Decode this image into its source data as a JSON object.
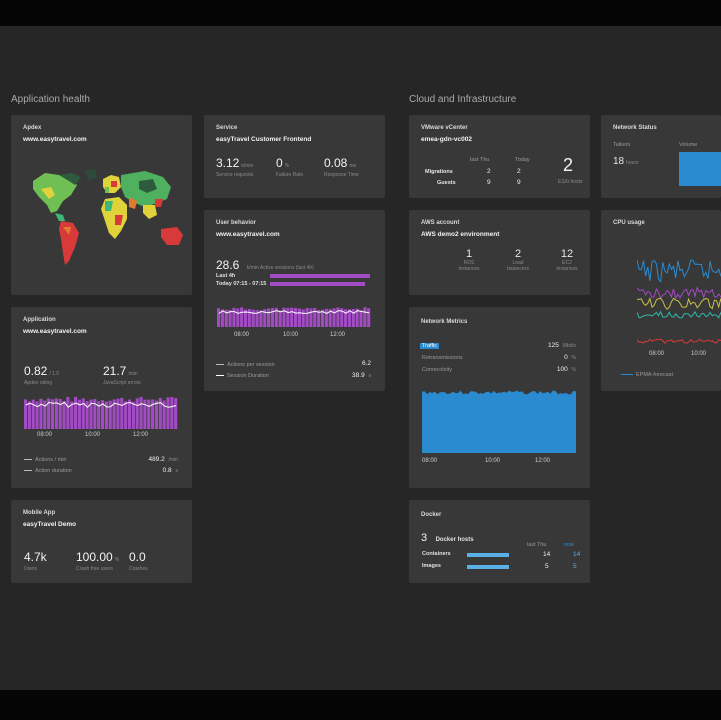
{
  "sections": {
    "app_health": "Application health",
    "cloud": "Cloud and Infrastructure"
  },
  "apdex": {
    "title": "Apdex",
    "subtitle": "www.easytravel.com"
  },
  "service": {
    "title": "Service",
    "subtitle": "easyTravel Customer Frontend",
    "metrics": [
      {
        "value": "3.12",
        "unit": "k/min",
        "label": "Service requests"
      },
      {
        "value": "0",
        "unit": "%",
        "label": "Failure Rate"
      },
      {
        "value": "0.08",
        "unit": "ms",
        "label": "Response Time"
      }
    ]
  },
  "user_behavior": {
    "title": "User behavior",
    "subtitle": "www.easytravel.com",
    "big": "28.6",
    "big_text": "k/min Active sessions (last 4h)",
    "rows": [
      {
        "label": "Last 4h",
        "fill": 1.0
      },
      {
        "label": "Today  07:15 - 07:15",
        "fill": 0.95
      }
    ],
    "x_ticks": [
      "08:00",
      "10:00",
      "12:00"
    ],
    "stats": [
      {
        "label": "Actions per session",
        "value": "6.2"
      },
      {
        "label": "Session Duration",
        "value": "38.9",
        "unit": "s"
      }
    ]
  },
  "application": {
    "title": "Application",
    "subtitle": "www.easytravel.com",
    "metrics": [
      {
        "value": "0.82",
        "unit": "/ 1.0",
        "label": "Apdex rating"
      },
      {
        "value": "21.7",
        "unit": "/min",
        "label": "JavaScript errors"
      }
    ],
    "x_ticks": [
      "08:00",
      "10:00",
      "12:00"
    ],
    "stats": [
      {
        "label": "Actions / min",
        "value": "489.2",
        "unit": "/min"
      },
      {
        "label": "Action duration",
        "value": "0.8",
        "unit": "s"
      }
    ]
  },
  "mobile": {
    "title": "Mobile App",
    "subtitle": "easyTravel Demo",
    "metrics": [
      {
        "value": "4.7k",
        "unit": "",
        "label": "Users"
      },
      {
        "value": "100.00",
        "unit": "%",
        "label": "Crash free users"
      },
      {
        "value": "0.0",
        "unit": "",
        "label": "Crashes"
      }
    ]
  },
  "vmware": {
    "title": "VMware vCenter",
    "subtitle": "emea-gdn-vc002",
    "col_headers": [
      "last Thu",
      "Today"
    ],
    "rows": [
      {
        "label": "Migrations",
        "a": "2",
        "b": "2"
      },
      {
        "label": "Guests",
        "a": "9",
        "b": "9"
      }
    ],
    "big": "2",
    "big_label": "ESXi hosts"
  },
  "aws": {
    "title": "AWS account",
    "subtitle": "AWS demo2 environment",
    "metrics": [
      {
        "value": "1",
        "label": "RDS instances"
      },
      {
        "value": "2",
        "label": "Load balancers"
      },
      {
        "value": "12",
        "label": "EC2 instances"
      }
    ]
  },
  "network_metrics": {
    "title": "Network Metrics",
    "rows": [
      {
        "label": "Traffic",
        "value": "125",
        "unit": "Mbit/s"
      },
      {
        "label": "Retransmissions",
        "value": "0",
        "unit": "%"
      },
      {
        "label": "Connectivity",
        "value": "100",
        "unit": "%"
      }
    ],
    "x_ticks": [
      "08:00",
      "10:00",
      "12:00"
    ]
  },
  "docker": {
    "title": "Docker",
    "hosts_value": "3",
    "hosts_label": "Docker hosts",
    "col_headers": [
      "last Thu",
      "now"
    ],
    "rows": [
      {
        "label": "Containers",
        "a": "14",
        "b": "14"
      },
      {
        "label": "Images",
        "a": "5",
        "b": "5"
      }
    ]
  },
  "network_status": {
    "title": "Network Status",
    "label1": "Talkers",
    "big": "18",
    "unit": "hours",
    "label2": "Volume"
  },
  "cpu": {
    "title": "CPU usage",
    "x_ticks": [
      "08:00",
      "10:00"
    ],
    "legend": "EPMA-forecast"
  },
  "colors": {
    "purple": "#a24bc4",
    "blue": "#2a8bd1",
    "tile": "#383838"
  }
}
